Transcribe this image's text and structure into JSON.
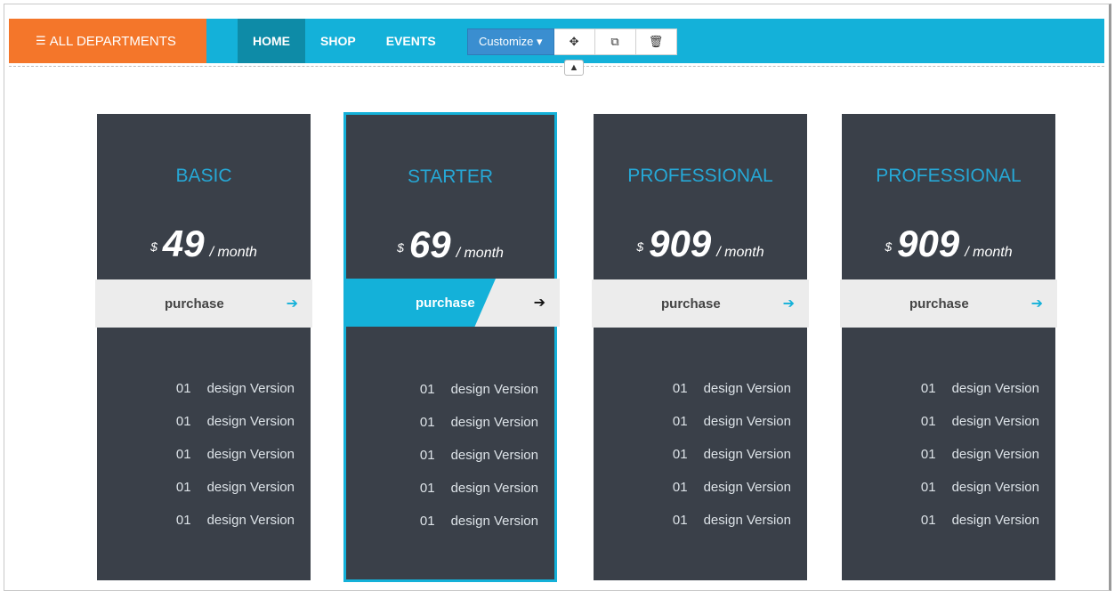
{
  "nav": {
    "departments_label": "ALL DEPARTMENTS",
    "links": [
      {
        "label": "HOME",
        "active": true
      },
      {
        "label": "SHOP",
        "active": false
      },
      {
        "label": "EVENTS",
        "active": false
      }
    ],
    "customize_label": "Customize ▾"
  },
  "colors": {
    "accent": "#14b1d9",
    "orange": "#f4762a",
    "card": "#3a4049",
    "title": "#26a8d6"
  },
  "plans": [
    {
      "title": "BASIC",
      "currency": "$",
      "amount": "49",
      "period": "/ month",
      "button": "purchase",
      "selected": false,
      "features": [
        {
          "num": "01",
          "text": "design Version"
        },
        {
          "num": "01",
          "text": "design Version"
        },
        {
          "num": "01",
          "text": "design Version"
        },
        {
          "num": "01",
          "text": "design Version"
        },
        {
          "num": "01",
          "text": "design Version"
        }
      ]
    },
    {
      "title": "STARTER",
      "currency": "$",
      "amount": "69",
      "period": "/ month",
      "button": "purchase",
      "selected": true,
      "features": [
        {
          "num": "01",
          "text": "design Version"
        },
        {
          "num": "01",
          "text": "design Version"
        },
        {
          "num": "01",
          "text": "design Version"
        },
        {
          "num": "01",
          "text": "design Version"
        },
        {
          "num": "01",
          "text": "design Version"
        }
      ]
    },
    {
      "title": "PROFESSIONAL",
      "currency": "$",
      "amount": "909",
      "period": "/ month",
      "button": "purchase",
      "selected": false,
      "features": [
        {
          "num": "01",
          "text": "design Version"
        },
        {
          "num": "01",
          "text": "design Version"
        },
        {
          "num": "01",
          "text": "design Version"
        },
        {
          "num": "01",
          "text": "design Version"
        },
        {
          "num": "01",
          "text": "design Version"
        }
      ]
    },
    {
      "title": "PROFESSIONAL",
      "currency": "$",
      "amount": "909",
      "period": "/ month",
      "button": "purchase",
      "selected": false,
      "features": [
        {
          "num": "01",
          "text": "design Version"
        },
        {
          "num": "01",
          "text": "design Version"
        },
        {
          "num": "01",
          "text": "design Version"
        },
        {
          "num": "01",
          "text": "design Version"
        },
        {
          "num": "01",
          "text": "design Version"
        }
      ]
    }
  ]
}
